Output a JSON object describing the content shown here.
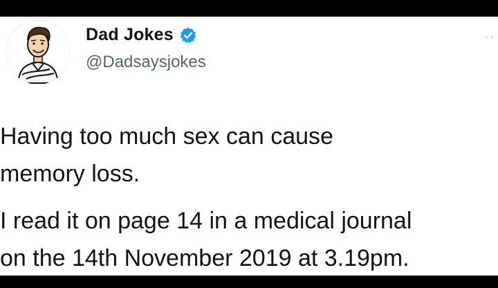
{
  "tweet": {
    "author": {
      "display_name": "Dad Jokes",
      "handle": "@Dadsaysjokes",
      "verified": true,
      "avatar_icon": "cartoon-man-avatar",
      "verified_icon": "verified-badge-icon"
    },
    "text_lines": [
      "Having too much sex can cause",
      "memory loss.",
      "I read it on page 14 in a medical journal",
      "on the 14th November 2019 at 3.19pm."
    ],
    "more_label": "··"
  },
  "colors": {
    "background": "#000000",
    "card": "#ffffff",
    "text": "#0f1419",
    "secondary": "#536471",
    "verified": "#1d9bf0"
  }
}
